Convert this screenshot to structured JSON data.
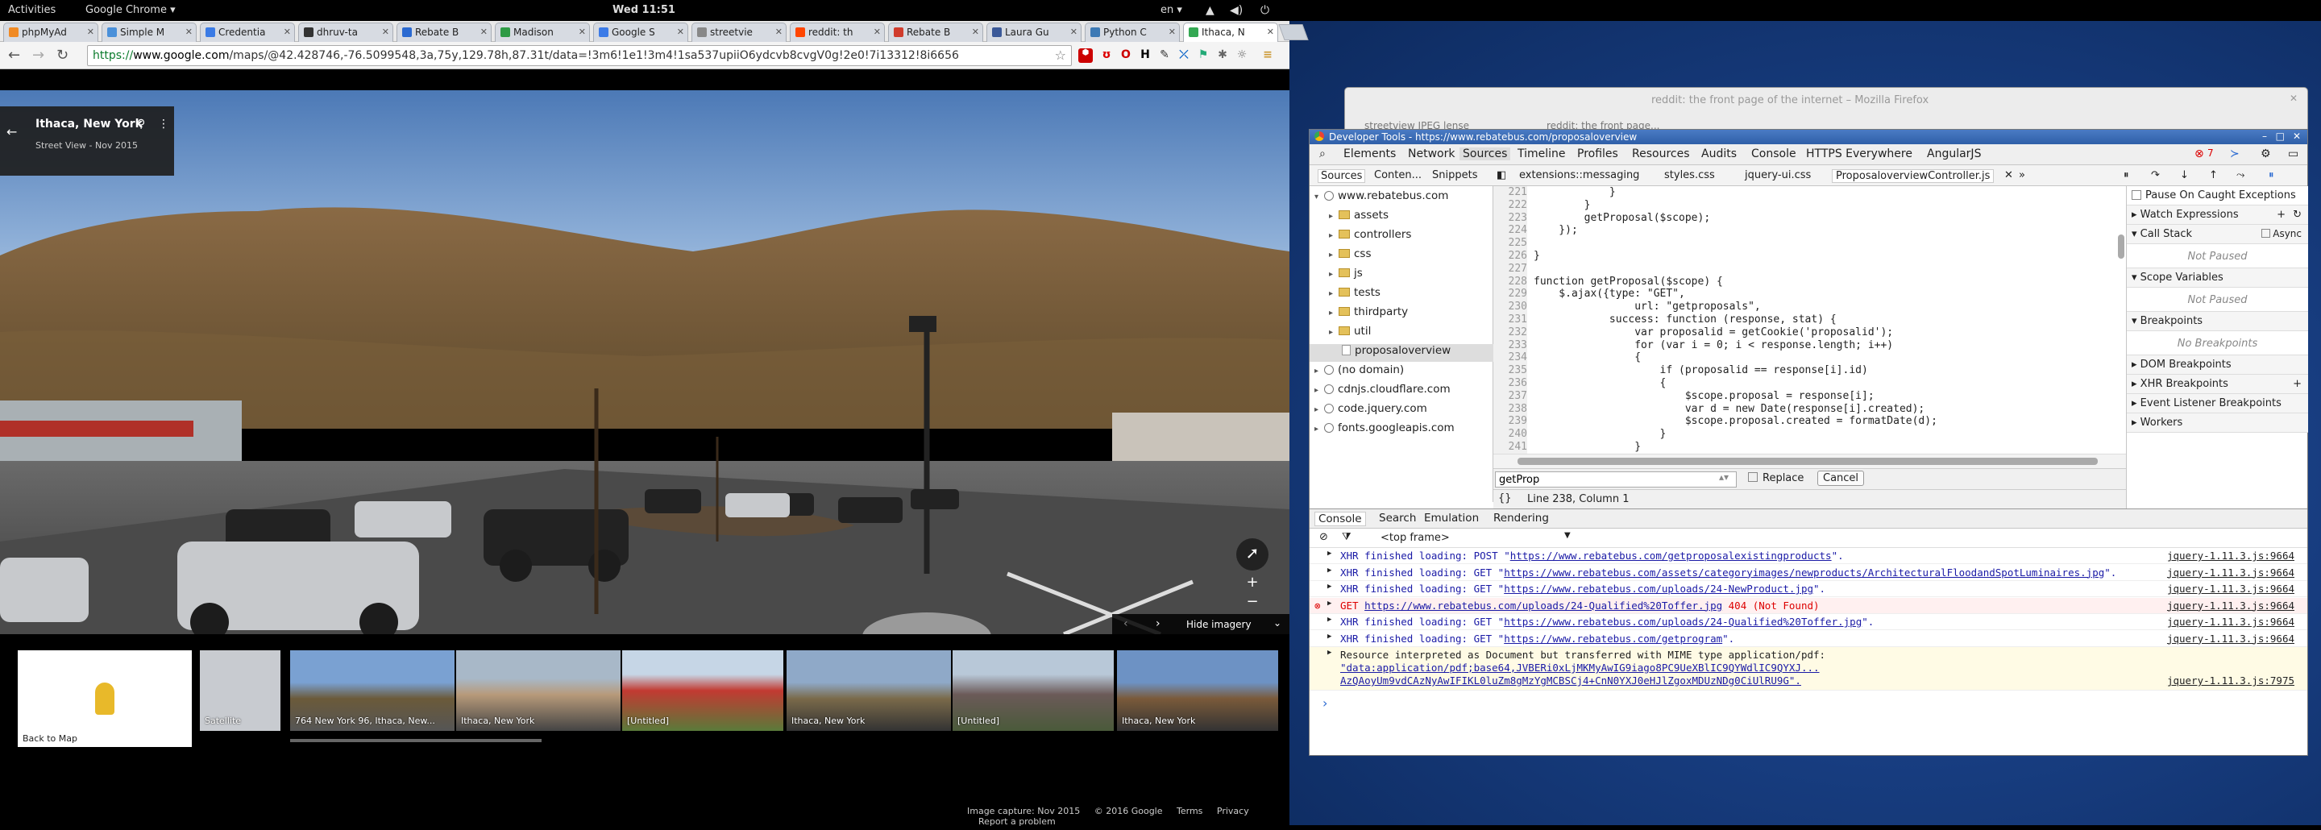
{
  "topbar": {
    "activities": "Activities",
    "app": "Google Chrome ▾",
    "clock": "Wed 11:51",
    "lang": "en ▾"
  },
  "chrome": {
    "tabs": [
      {
        "label": "phpMyAd",
        "color": "#f08a24"
      },
      {
        "label": "Simple M",
        "color": "#4a90d9"
      },
      {
        "label": "Credentia",
        "color": "#3b7be5"
      },
      {
        "label": "dhruv-ta",
        "color": "#333333"
      },
      {
        "label": "Rebate B",
        "color": "#2b6ad1"
      },
      {
        "label": "Madison",
        "color": "#2e9b45"
      },
      {
        "label": "Google S",
        "color": "#3c7be7"
      },
      {
        "label": "streetvie",
        "color": "#888888"
      },
      {
        "label": "reddit: th",
        "color": "#ff4500"
      },
      {
        "label": "Rebate B",
        "color": "#d03c2c"
      },
      {
        "label": "Laura Gu",
        "color": "#3b5998"
      },
      {
        "label": "Python C",
        "color": "#3d7ab5"
      },
      {
        "label": "Ithaca, N",
        "color": "#34a853"
      }
    ],
    "url_secure": "https://",
    "url_host": "www.google.com",
    "url_rest": "/maps/@42.428746,-76.5099548,3a,75y,129.78h,87.31t/data=!3m6!1e1!3m4!1sa537upiiO6ydcvb8cvgV0g!2e0!7i13312!8i6656"
  },
  "streetview": {
    "place": "Ithaca, New York",
    "subtitle": "Street View - Nov 2015",
    "hide_imagery": "Hide imagery",
    "back_to_map": "Back to Map",
    "thumbs": [
      {
        "label": "Satellite"
      },
      {
        "label": "764 New York 96, Ithaca, New..."
      },
      {
        "label": "Ithaca, New York"
      },
      {
        "label": "[Untitled]"
      },
      {
        "label": "Ithaca, New York"
      },
      {
        "label": "[Untitled]"
      },
      {
        "label": "Ithaca, New York"
      }
    ],
    "footer": {
      "capture": "Image capture: Nov 2015",
      "copyright": "© 2016 Google",
      "terms": "Terms",
      "privacy": "Privacy",
      "report": "Report a problem"
    }
  },
  "firefox": {
    "title": "reddit: the front page of the internet – Mozilla Firefox",
    "tab1": "streetview JPEG lense",
    "tab2": "reddit: the front page..."
  },
  "devtools": {
    "title": "Developer Tools - https://www.rebatebus.com/proposaloverview",
    "menu": [
      "Elements",
      "Network",
      "Sources",
      "Timeline",
      "Profiles",
      "Resources",
      "Audits",
      "Console",
      "HTTPS Everywhere",
      "AngularJS"
    ],
    "error_count": "7",
    "src_tabs": [
      "Sources",
      "Conten...",
      "Snippets"
    ],
    "file_tabs": [
      "extensions::messaging",
      "styles.css",
      "jquery-ui.css",
      "ProposaloverviewController.js"
    ],
    "tree": [
      {
        "label": "www.rebatebus.com",
        "kind": "globe",
        "open": true
      },
      {
        "label": "assets",
        "kind": "folder"
      },
      {
        "label": "controllers",
        "kind": "folder"
      },
      {
        "label": "css",
        "kind": "folder"
      },
      {
        "label": "js",
        "kind": "folder"
      },
      {
        "label": "tests",
        "kind": "folder"
      },
      {
        "label": "thirdparty",
        "kind": "folder"
      },
      {
        "label": "util",
        "kind": "folder"
      },
      {
        "label": "proposaloverview",
        "kind": "file"
      },
      {
        "label": "(no domain)",
        "kind": "globe"
      },
      {
        "label": "cdnjs.cloudflare.com",
        "kind": "globe"
      },
      {
        "label": "code.jquery.com",
        "kind": "globe"
      },
      {
        "label": "fonts.googleapis.com",
        "kind": "globe"
      }
    ],
    "code": [
      {
        "n": "221",
        "t": "            }"
      },
      {
        "n": "222",
        "t": "        }"
      },
      {
        "n": "223",
        "t": "        getProposal($scope);"
      },
      {
        "n": "224",
        "t": "    });"
      },
      {
        "n": "225",
        "t": ""
      },
      {
        "n": "226",
        "t": "}"
      },
      {
        "n": "227",
        "t": ""
      },
      {
        "n": "228",
        "t": "function getProposal($scope) {"
      },
      {
        "n": "229",
        "t": "    $.ajax({type: \"GET\","
      },
      {
        "n": "230",
        "t": "                url: \"getproposals\","
      },
      {
        "n": "231",
        "t": "            success: function (response, stat) {"
      },
      {
        "n": "232",
        "t": "                var proposalid = getCookie('proposalid');"
      },
      {
        "n": "233",
        "t": "                for (var i = 0; i < response.length; i++)"
      },
      {
        "n": "234",
        "t": "                {"
      },
      {
        "n": "235",
        "t": "                    if (proposalid == response[i].id)"
      },
      {
        "n": "236",
        "t": "                    {"
      },
      {
        "n": "237",
        "t": "                        $scope.proposal = response[i];"
      },
      {
        "n": "238",
        "t": "                        var d = new Date(response[i].created);"
      },
      {
        "n": "239",
        "t": "                        $scope.proposal.created = formatDate(d);"
      },
      {
        "n": "240",
        "t": "                    }"
      },
      {
        "n": "241",
        "t": "                }"
      }
    ],
    "find_value": "getProp",
    "replace_label": "Replace",
    "cancel_label": "Cancel",
    "status": "Line 238, Column 1",
    "side": {
      "pause_caught": "Pause On Caught Exceptions",
      "watch": "Watch Expressions",
      "callstack": "Call Stack",
      "async": "Async",
      "not_paused": "Not Paused",
      "scope": "Scope Variables",
      "breakpoints": "Breakpoints",
      "no_breakpoints": "No Breakpoints",
      "dom_bp": "DOM Breakpoints",
      "xhr_bp": "XHR Breakpoints",
      "event_bp": "Event Listener Breakpoints",
      "workers": "Workers"
    },
    "drawer_tabs": [
      "Console",
      "Search",
      "Emulation",
      "Rendering"
    ],
    "frame": "<top frame>",
    "log": [
      {
        "kind": "xhr",
        "pre": "XHR finished loading: POST \"",
        "url": "https://www.rebatebus.com/getproposalexistingproducts",
        "post": "\".",
        "src": "jquery-1.11.3.js:9664"
      },
      {
        "kind": "xhr",
        "pre": "XHR finished loading: GET \"",
        "url": "https://www.rebatebus.com/assets/categoryimages/newproducts/ArchitecturalFloodandSpotLuminaires.jpg",
        "post": "\".",
        "src": "jquery-1.11.3.js:9664"
      },
      {
        "kind": "xhr",
        "pre": "XHR finished loading: GET \"",
        "url": "https://www.rebatebus.com/uploads/24-NewProduct.jpg",
        "post": "\".",
        "src": "jquery-1.11.3.js:9664"
      },
      {
        "kind": "err",
        "pre": "GET ",
        "url": "https://www.rebatebus.com/uploads/24-Qualified%20Toffer.jpg",
        "post": " 404 (Not Found)",
        "src": "jquery-1.11.3.js:9664"
      },
      {
        "kind": "xhr",
        "pre": "XHR finished loading: GET \"",
        "url": "https://www.rebatebus.com/uploads/24-Qualified%20Toffer.jpg",
        "post": "\".",
        "src": "jquery-1.11.3.js:9664"
      },
      {
        "kind": "xhr",
        "pre": "XHR finished loading: GET \"",
        "url": "https://www.rebatebus.com/getprogram",
        "post": "\".",
        "src": "jquery-1.11.3.js:9664"
      }
    ],
    "mime_line1": "Resource interpreted as Document but transferred with MIME type application/pdf:",
    "mime_line2": "\"data:application/pdf;base64,JVBERi0xLjMKMyAwIG9iago8PC9UeXBlIC9QYWdlIC9QYXJ...",
    "mime_line3": "AzQAoyUm9vdCAzNyAwIFIKL0luZm8gMzYgMCBSCj4+CnN0YXJ0eHJlZgoxMDUzNDg0CiUlRU9G\".",
    "mime_src": "jquery-1.11.3.js:7975",
    "prompt": "›"
  }
}
